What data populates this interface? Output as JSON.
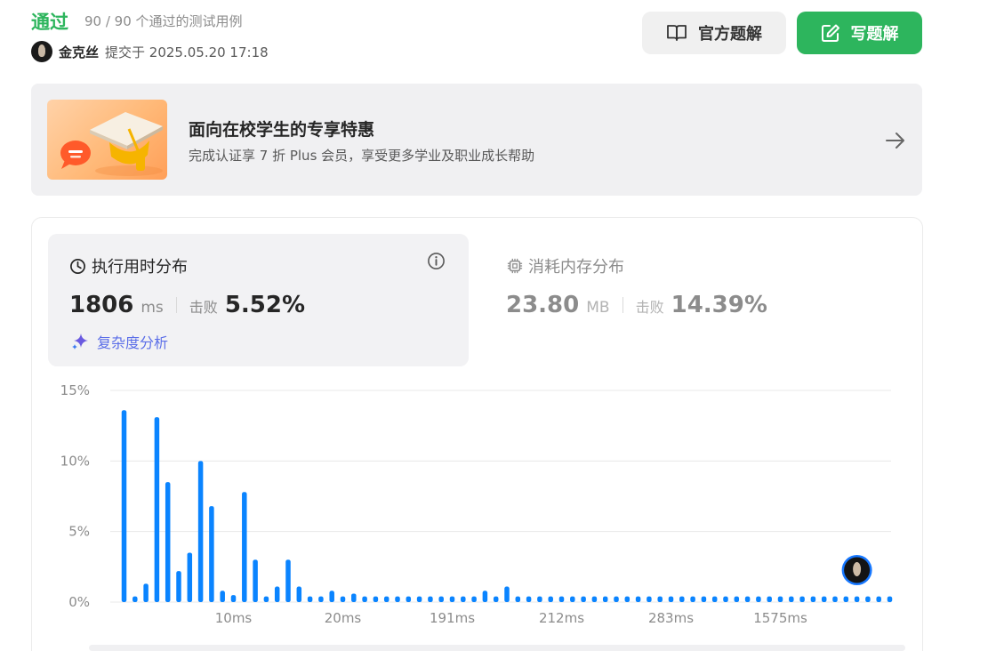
{
  "header": {
    "status": "通过",
    "cases": "90 / 90 个通过的测试用例",
    "username": "金克丝",
    "submitted": "提交于 2025.05.20 17:18"
  },
  "buttons": {
    "official_label": "官方题解",
    "write_label": "写题解"
  },
  "banner": {
    "title": "面向在校学生的专享特惠",
    "subtitle": "完成认证享 7 折 Plus 会员，享受更多学业及职业成长帮助"
  },
  "runtime": {
    "title": "执行用时分布",
    "value": "1806",
    "unit": "ms",
    "beat_label": "击败",
    "beat_pct": "5.52%",
    "complexity_label": "复杂度分析"
  },
  "memory": {
    "title": "消耗内存分布",
    "value": "23.80",
    "unit": "MB",
    "beat_label": "击败",
    "beat_pct": "14.39%"
  },
  "colors": {
    "accent_green": "#2db55d",
    "bar_blue": "#0a84ff",
    "complexity_purple": "#5b6ee8"
  },
  "chart_data": {
    "type": "bar",
    "ylim": [
      0,
      15
    ],
    "yticks": [
      "0%",
      "5%",
      "10%",
      "15%"
    ],
    "xtick_labels": [
      {
        "index": 10,
        "label": "10ms"
      },
      {
        "index": 20,
        "label": "20ms"
      },
      {
        "index": 30,
        "label": "191ms"
      },
      {
        "index": 40,
        "label": "212ms"
      },
      {
        "index": 50,
        "label": "283ms"
      },
      {
        "index": 60,
        "label": "1575ms"
      }
    ],
    "values": [
      13.6,
      0.4,
      1.3,
      13.1,
      8.5,
      2.2,
      3.5,
      10.0,
      6.8,
      0.8,
      0.5,
      7.8,
      3.0,
      0.4,
      1.1,
      3.0,
      1.1,
      0.4,
      0.4,
      0.8,
      0.4,
      0.6,
      0.4,
      0.4,
      0.4,
      0.4,
      0.4,
      0.4,
      0.4,
      0.4,
      0.4,
      0.4,
      0.4,
      0.8,
      0.4,
      1.1,
      0.4,
      0.4,
      0.4,
      0.4,
      0.4,
      0.4,
      0.4,
      0.4,
      0.4,
      0.4,
      0.4,
      0.4,
      0.4,
      0.4,
      0.4,
      0.4,
      0.4,
      0.4,
      0.4,
      0.4,
      0.4,
      0.4,
      0.4,
      0.4,
      0.4,
      0.4,
      0.4,
      0.4,
      0.4,
      0.4,
      0.4,
      0.4,
      0.4,
      0.4,
      0.4
    ],
    "current_index": 67
  }
}
